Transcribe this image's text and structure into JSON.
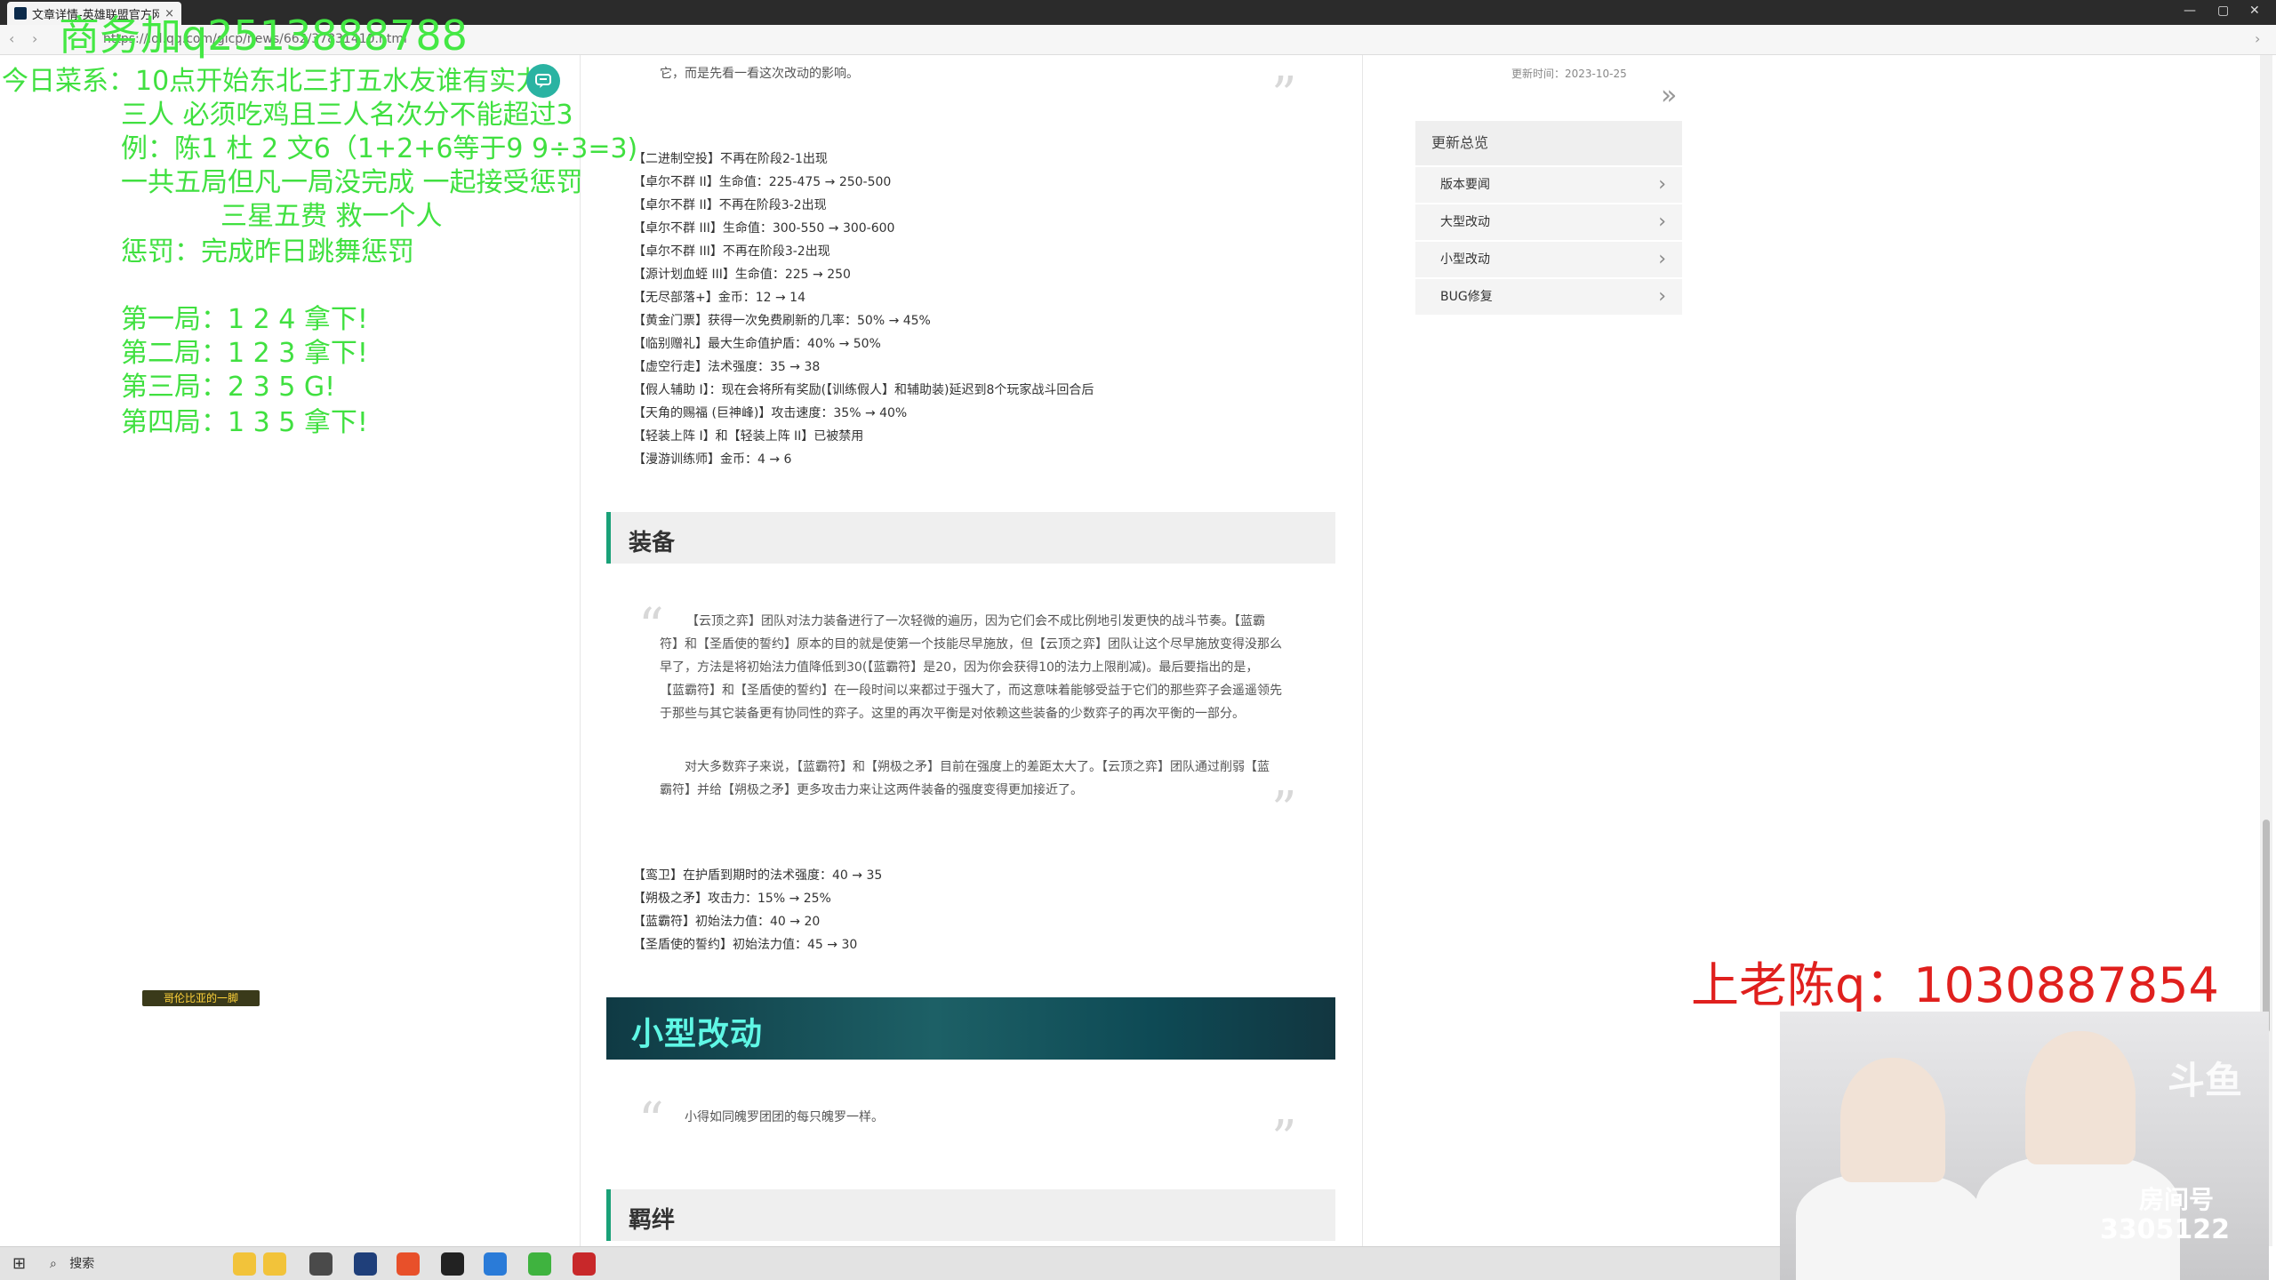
{
  "browser": {
    "tab_title": "文章详情-英雄联盟官方网站",
    "tab_close": "×",
    "url": "https://lol.qq.com/gicp/news/662/37831410.html",
    "back": "‹",
    "forward": "›",
    "win_min": "—",
    "win_max": "▢",
    "win_close": "✕"
  },
  "article": {
    "intro_tail": "它，而是先看一看这次改动的影响。",
    "augments": [
      "【二进制空投】不再在阶段2-1出现",
      "【卓尔不群 II】生命值：225-475 → 250-500",
      "【卓尔不群 II】不再在阶段3-2出现",
      "【卓尔不群 III】生命值：300-550 → 300-600",
      "【卓尔不群 III】不再在阶段3-2出现",
      "【源计划血蛭 III】生命值：225 → 250",
      "【无尽部落+】金币：12 → 14",
      "【黄金门票】获得一次免费刷新的几率：50% → 45%",
      "【临别赠礼】最大生命值护盾：40% → 50%",
      "【虚空行走】法术强度：35 → 38",
      "【假人辅助 I】：现在会将所有奖励(【训练假人】和辅助装)延迟到8个玩家战斗回合后",
      "【天角的赐福 (巨神峰)】攻击速度：35% → 40%",
      "【轻装上阵 I】和【轻装上阵 II】已被禁用",
      "【漫游训练师】金币：4 → 6"
    ],
    "equipment_title": "装备",
    "equipment_quote_1": [
      "【云顶之弈】团队对法力装备进行了一次轻微的遍历，因为它们会不成比例地引发更快的战斗节奏。【蓝霸",
      "符】和【圣盾使的誓约】原本的目的就是使第一个技能尽早施放，但【云顶之弈】团队让这个尽早施放变得没那么",
      "早了，方法是将初始法力值降低到30(【蓝霸符】是20，因为你会获得10的法力上限削减)。最后要指出的是，",
      "【蓝霸符】和【圣盾使的誓约】在一段时间以来都过于强大了，而这意味着能够受益于它们的那些弈子会遥遥领先",
      "于那些与其它装备更有协同性的弈子。这里的再次平衡是对依赖这些装备的少数弈子的再次平衡的一部分。"
    ],
    "equipment_quote_2": [
      "对大多数弈子来说，【蓝霸符】和【朔极之矛】目前在强度上的差距太大了。【云顶之弈】团队通过削弱【蓝",
      "霸符】并给【朔极之矛】更多攻击力来让这两件装备的强度变得更加接近了。"
    ],
    "equipment_changes": [
      "【鸾卫】在护盾到期时的法术强度：40 → 35",
      "【朔极之矛】攻击力：15% → 25%",
      "【蓝霸符】初始法力值：40 → 20",
      "【圣盾使的誓约】初始法力值：45 → 30"
    ],
    "small_changes_title": "小型改动",
    "small_changes_quote": "小得如同魄罗团团的每只魄罗一样。",
    "traits_title": "羁绊",
    "quote_open": "“",
    "quote_close": "”"
  },
  "sidebar": {
    "update_time": "更新时间：2023-10-25",
    "double_arrow": "»",
    "overview_title": "更新总览",
    "items": [
      {
        "label": "版本要闻"
      },
      {
        "label": "大型改动"
      },
      {
        "label": "小型改动"
      },
      {
        "label": "BUG修复"
      }
    ],
    "chevron": "›"
  },
  "overlay": {
    "contact": "商务加q2513888788",
    "lines": [
      "今日菜系：10点开始东北三打五水友谁有实力",
      "三人 必须吃鸡且三人名次分不能超过3",
      "例：陈1 杜 2 文6（1+2+6等于9   9÷3=3)",
      "一共五局但凡一局没完成 一起接受惩罚",
      "三星五费 救一个人",
      "惩罚：完成昨日跳舞惩罚",
      "第一局：1 2 4 拿下!",
      "第二局：1 2 3 拿下!",
      "第三局：2 3 5 G!",
      "第四局：1 3 5 拿下!"
    ],
    "badge": "哥伦比亚的一脚",
    "red_contact": "上老陈q：1030887854",
    "room_brand": "斗鱼",
    "room_label": "房间号",
    "room_number": "3305122"
  },
  "taskbar": {
    "start": "⊞",
    "search_icon": "⌕",
    "search_label": "搜索"
  },
  "colors": {
    "accent": "#1aa178",
    "overlay_green": "#40e040",
    "overlay_red": "#e0201e",
    "banner_text": "#5ff7e5"
  }
}
